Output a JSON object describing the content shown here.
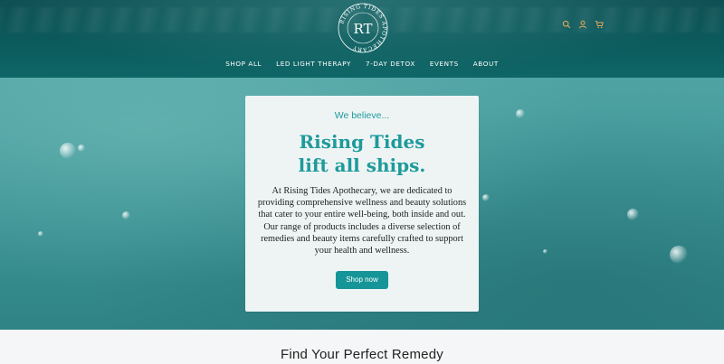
{
  "logo": {
    "monogram": "RT",
    "ring_text": "RISING TIDES APOTHECARY"
  },
  "nav": {
    "items": [
      {
        "label": "SHOP ALL"
      },
      {
        "label": "LED LIGHT THERAPY"
      },
      {
        "label": "7-DAY DETOX"
      },
      {
        "label": "EVENTS"
      },
      {
        "label": "ABOUT"
      }
    ]
  },
  "header_icons": [
    "search-icon",
    "account-icon",
    "cart-icon"
  ],
  "hero": {
    "eyebrow": "We believe...",
    "headline_line1": "Rising Tides",
    "headline_line2": "lift all ships.",
    "body": "At Rising Tides Apothecary, we are dedicated to providing comprehensive wellness and beauty solutions that cater to your entire well-being, both inside and out. Our range of products includes a diverse selection of remedies and beauty items carefully crafted to support your health and wellness.",
    "cta_label": "Shop now"
  },
  "section": {
    "title": "Find Your Perfect Remedy"
  },
  "colors": {
    "accent": "#1e9a9b",
    "button": "#159597",
    "header_bg": "#0b5a5c",
    "icon_orange": "#e0a65a"
  }
}
